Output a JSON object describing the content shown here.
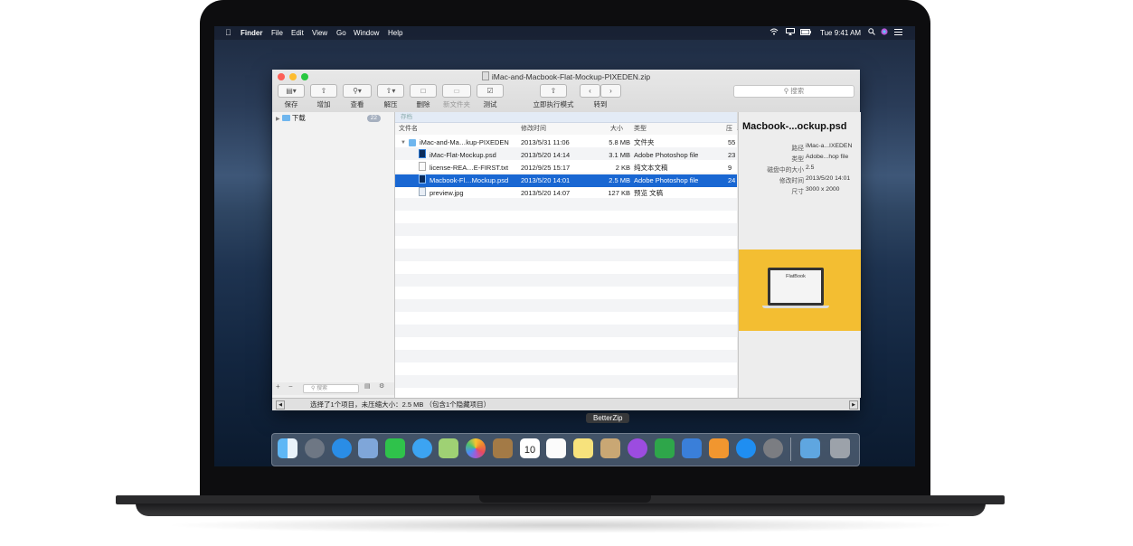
{
  "menubar": {
    "apple": "",
    "items": [
      "Finder",
      "File",
      "Edit",
      "View",
      "Go",
      "Window",
      "Help"
    ],
    "clock": "Tue 9:41 AM"
  },
  "window": {
    "title": "iMac-and-Macbook-Flat-Mockup-PIXEDEN.zip",
    "toolbar": {
      "save": "保存",
      "add": "增加",
      "view": "查看",
      "extract": "解压",
      "delete": "删除",
      "new_folder": "新文件夹",
      "test": "测试",
      "instant_mode": "立即执行模式",
      "goto": "转到",
      "search_placeholder": "搜索"
    },
    "sidebar": {
      "item_label": "下载",
      "item_count": "22",
      "search_placeholder": "搜索"
    },
    "pathbar": "存档",
    "columns": [
      "文件名",
      "修改时间",
      "大小",
      "类型",
      "压缩"
    ],
    "rows": [
      {
        "name": "iMac-and-Ma…kup-PIXEDEN",
        "date": "2013/5/31 11:06",
        "size": "5.8 MB",
        "type": "文件夹",
        "comp": "55"
      },
      {
        "name": "iMac-Flat-Mockup.psd",
        "date": "2013/5/20 14:14",
        "size": "3.1 MB",
        "type": "Adobe Photoshop file",
        "comp": "23"
      },
      {
        "name": "license-REA…E-FIRST.txt",
        "date": "2012/9/25 15:17",
        "size": "2 KB",
        "type": "纯文本文稿",
        "comp": "9"
      },
      {
        "name": "Macbook-Fl…Mockup.psd",
        "date": "2013/5/20 14:01",
        "size": "2.5 MB",
        "type": "Adobe Photoshop file",
        "comp": "24"
      },
      {
        "name": "preview.jpg",
        "date": "2013/5/20 14:07",
        "size": "127 KB",
        "type": "预览 文稿",
        "comp": ""
      }
    ],
    "preview": {
      "title": "Macbook-...ockup.psd",
      "info": [
        {
          "k": "路径",
          "v": "iMac-a...IXEDEN"
        },
        {
          "k": "类型",
          "v": "Adobe...hop file"
        },
        {
          "k": "磁盘中的大小",
          "v": "2.5"
        },
        {
          "k": "修改时间",
          "v": "2013/5/20 14:01"
        },
        {
          "k": "尺寸",
          "v": "3000 x 2000"
        }
      ],
      "thumb_text": "FlatBook"
    },
    "status": "选择了1个项目，未压缩大小：2.5 MB （包含1个隐藏项目）"
  },
  "dock": {
    "tooltip": "BetterZip",
    "icons": [
      "finder-icon",
      "launchpad-icon",
      "safari-icon",
      "mail-icon",
      "facetime-icon",
      "messages-icon",
      "maps-icon",
      "photos-icon",
      "contacts-icon",
      "calendar-icon",
      "reminders-icon",
      "notes-icon",
      "betterzip-icon",
      "podcasts-icon",
      "numbers-icon",
      "keynote-icon",
      "pages-icon",
      "app-store-icon",
      "system-preferences-icon",
      "downloads-icon",
      "trash-icon"
    ],
    "calendar_day": "10"
  }
}
